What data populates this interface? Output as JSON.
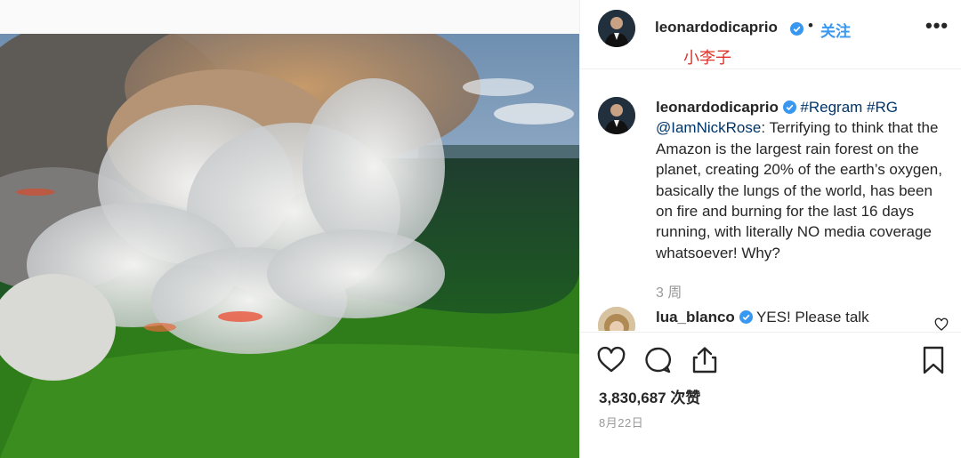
{
  "header": {
    "username": "leonardodicaprio",
    "separator": "•",
    "follow_label": "关注",
    "more_label": "•••",
    "watermark": "小李子"
  },
  "caption": {
    "username": "leonardodicaprio",
    "tags": [
      "#Regram",
      "#RG",
      "@IamNickRose"
    ],
    "text": ": Terrifying to think that the Amazon is the largest rain forest on the planet, creating 20% of the earth’s oxygen, basically the lungs of the world, has been on fire and burning for the last 16 days running, with literally NO media coverage whatsoever! Why?",
    "time_ago": "3 周"
  },
  "comment": {
    "username": "lua_blanco",
    "text": "YES! Please talk"
  },
  "stats": {
    "likes": "3,830,687 次赞",
    "date": "8月22日"
  },
  "icons": {
    "verified": "verified-badge-icon",
    "like": "heart-icon",
    "comment": "comment-bubble-icon",
    "share": "share-icon",
    "save": "bookmark-icon"
  },
  "colors": {
    "link": "#3897f0",
    "hashtag": "#003569",
    "watermark": "#e0322b",
    "muted": "#999999"
  }
}
